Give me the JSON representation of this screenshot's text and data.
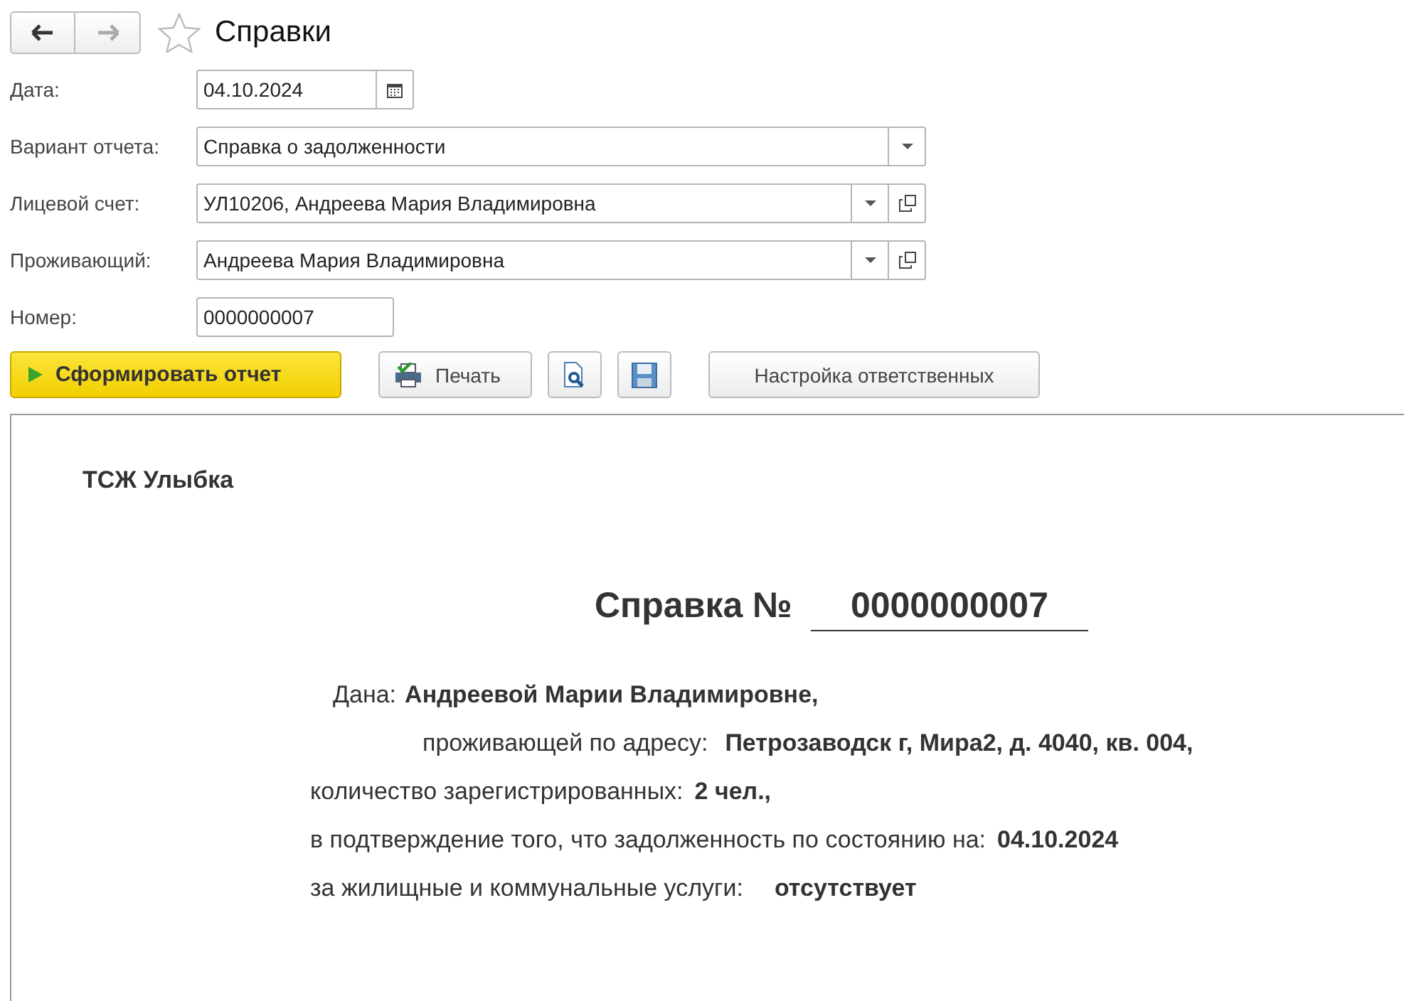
{
  "window": {
    "title": "Справки",
    "favorite": false
  },
  "fields": [
    {
      "label": "Дата:",
      "value": "04.10.2024",
      "kind": "date"
    },
    {
      "label": "Вариант отчета:",
      "value": "Справка о задолженности",
      "kind": "dropdown"
    },
    {
      "label": "Лицевой счет:",
      "value": "УЛ10206, Андреева Мария Владимировна",
      "kind": "dropdown_open"
    },
    {
      "label": "Проживающий:",
      "value": "Андреева Мария Владимировна",
      "kind": "dropdown_open"
    },
    {
      "label": "Номер:",
      "value": "0000000007",
      "kind": "text"
    }
  ],
  "buttons": [
    {
      "label": "Сформировать отчет",
      "kind": "primary"
    },
    {
      "label": "Печать",
      "kind": "print"
    },
    {
      "kind": "preview"
    },
    {
      "kind": "save"
    },
    {
      "label": "Настройка ответственных",
      "kind": "plain"
    }
  ],
  "report": {
    "organization": "ТСЖ Улыбка",
    "title": "Справка №",
    "number": "0000000007",
    "lines": [
      {
        "label": "Дана:",
        "value": "Андреевой Марии Владимировне,"
      },
      {
        "label": "проживающей по адресу:",
        "value": "Петрозаводск г, Мира2, д. 4040, кв. 004,"
      },
      {
        "label": "количество зарегистрированных:",
        "value": "2 чел.,"
      },
      {
        "label": "в подтверждение того, что задолженность по состоянию на:",
        "value": "04.10.2024"
      },
      {
        "label": "за жилищные и коммунальные услуги:",
        "value": "отсутствует"
      }
    ]
  }
}
